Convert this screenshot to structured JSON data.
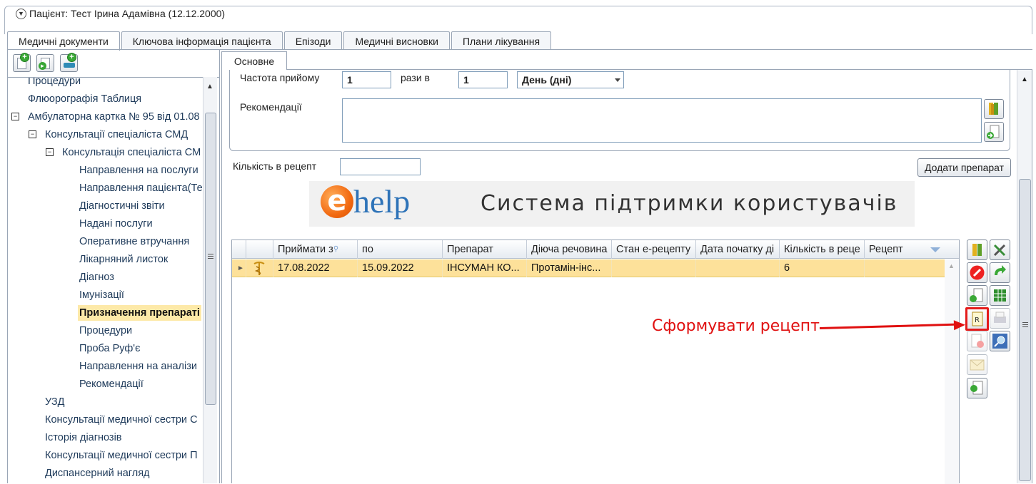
{
  "patient": {
    "title": "Пацієнт: Тест Ірина Адамівна (12.12.2000)"
  },
  "main_tabs": [
    {
      "label": "Медичні документи",
      "active": true
    },
    {
      "label": "Ключова інформація пацієнта"
    },
    {
      "label": "Епізоди"
    },
    {
      "label": "Медичні висновки"
    },
    {
      "label": "Плани лікування"
    }
  ],
  "tree": [
    {
      "label": "Процедури"
    },
    {
      "label": "Флюорографія Таблиця"
    },
    {
      "label": "Амбулаторна картка № 95 від 01.08"
    },
    {
      "label": "Консультації спеціаліста СМД"
    },
    {
      "label": "Консультація спеціаліста СМ"
    },
    {
      "label": "Направлення на послуги"
    },
    {
      "label": "Направлення пацієнта(Те"
    },
    {
      "label": "Діагностичні звіти"
    },
    {
      "label": "Надані послуги"
    },
    {
      "label": "Оперативне втручання"
    },
    {
      "label": "Лікарняний листок"
    },
    {
      "label": "Діагноз"
    },
    {
      "label": "Імунізації"
    },
    {
      "label": "Призначення препараті",
      "selected": true
    },
    {
      "label": "Процедури"
    },
    {
      "label": "Проба Руф'є"
    },
    {
      "label": "Направлення на аналізи"
    },
    {
      "label": "Рекомендації"
    },
    {
      "label": "УЗД"
    },
    {
      "label": "Консультації медичної сестри С"
    },
    {
      "label": "Історія діагнозів"
    },
    {
      "label": "Консультації медичної сестри П"
    },
    {
      "label": "Диспансерний нагляд"
    }
  ],
  "sub_tab": {
    "label": "Основне"
  },
  "form": {
    "freq_label": "Частота прийому",
    "freq_value": "1",
    "times_label": "рази в",
    "times_value": "1",
    "period_value": "День (дні)",
    "recommend_label": "Рекомендації",
    "qty_label": "Кількість в рецепт",
    "qty_value": "",
    "add_button": "Додати препарат"
  },
  "banner": {
    "logo_e": "e",
    "logo_help": "help",
    "text": "Система підтримки користувачів"
  },
  "grid": {
    "columns": [
      "Приймати з",
      "по",
      "Препарат",
      "Діюча речовина",
      "Стан е-рецепту",
      "Дата початку ді",
      "Кількість в реце",
      "Рецепт"
    ],
    "rows": [
      {
        "from": "17.08.2022",
        "to": "15.09.2022",
        "drug": "ІНСУМАН КО...",
        "substance": "Протамін-інс...",
        "state": "",
        "start_date": "",
        "qty": "6",
        "recipe": ""
      }
    ]
  },
  "annotation": {
    "text": "Сформувати рецепт"
  },
  "colors": {
    "selection": "#fde19a",
    "annotation": "#e01010",
    "border": "#9aa6b6"
  }
}
